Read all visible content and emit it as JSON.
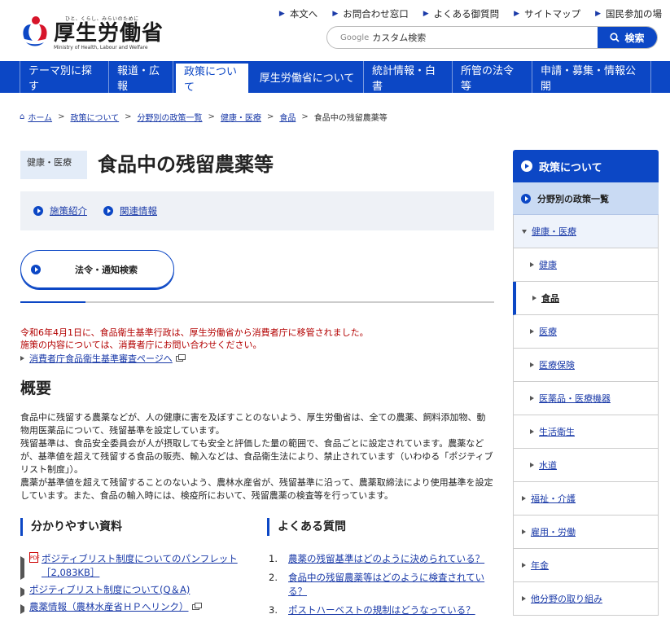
{
  "header": {
    "tagline": "ひと、くらし、みらいのために",
    "logo_name": "厚生労働省",
    "logo_en": "Ministry of Health, Labour and Welfare",
    "util_links": [
      "本文へ",
      "お問合わせ窓口",
      "よくある御質問",
      "サイトマップ",
      "国民参加の場"
    ],
    "search_brand": "Google",
    "search_placeholder": "カスタム検索",
    "search_button": "検索"
  },
  "nav": {
    "items": [
      "テーマ別に探す",
      "報道・広報",
      "政策について",
      "厚生労働省について",
      "統計情報・白書",
      "所管の法令等",
      "申請・募集・情報公開"
    ],
    "active_index": 2
  },
  "breadcrumb": [
    "ホーム",
    "政策について",
    "分野別の政策一覧",
    "健康・医療",
    "食品",
    "食品中の残留農薬等"
  ],
  "page": {
    "category": "健康・医療",
    "title": "食品中の残留農薬等",
    "subnav": [
      "施策紹介",
      "関連情報"
    ],
    "law_button": "法令・通知検索",
    "notice_line1": "令和6年4月1日に、食品衛生基準行政は、厚生労働省から消費者庁に移管されました。",
    "notice_line2": "施策の内容については、消費者庁にお問い合わせください。",
    "notice_link": "消費者庁食品衛生基準審査ページへ",
    "overview_title": "概要",
    "overview_p1": "食品中に残留する農薬などが、人の健康に害を及ぼすことのないよう、厚生労働省は、全ての農薬、飼料添加物、動物用医薬品について、残留基準を設定しています。",
    "overview_p2": "残留基準は、食品安全委員会が人が摂取しても安全と評価した量の範囲で、食品ごとに設定されています。農薬などが、基準値を超えて残留する食品の販売、輸入などは、食品衛生法により、禁止されています（いわゆる「ポジティブリスト制度」）。",
    "overview_p3": "農薬が基準値を超えて残留することのないよう、農林水産省が、残留基準に沿って、農薬取締法により使用基準を設定しています。また、食品の輸入時には、検疫所において、残留農薬の検査等を行っています。"
  },
  "resources": {
    "title": "分かりやすい資料",
    "items": [
      {
        "label": "ポジティブリスト制度についてのパンフレット",
        "size": "［2,083KB］"
      },
      {
        "label": "ポジティブリスト制度について(Q＆A)"
      },
      {
        "label": "農薬情報（農林水産省ＨＰへリンク）"
      }
    ]
  },
  "faq": {
    "title": "よくある質問",
    "items": [
      {
        "num": "1.",
        "label": "農薬の残留基準はどのように決められている？"
      },
      {
        "num": "2.",
        "label": "食品中の残留農薬等はどのように検査されている？"
      },
      {
        "num": "3.",
        "label": "ポストハーベストの規制はどうなっている？"
      }
    ]
  },
  "sidebar": {
    "head": "政策について",
    "sub": "分野別の政策一覧",
    "open": "健康・医療",
    "children": [
      "健康",
      "食品",
      "医療",
      "医療保険",
      "医薬品・医療機器",
      "生活衛生",
      "水道"
    ],
    "current_index": 1,
    "others": [
      "福祉・介護",
      "雇用・労働",
      "年金",
      "他分野の取り組み"
    ]
  },
  "colors": {
    "primary": "#0c47c5",
    "notice": "#b30000",
    "sub_bg": "#eef1f6"
  }
}
